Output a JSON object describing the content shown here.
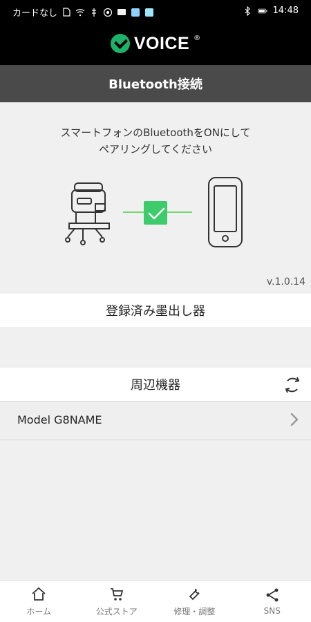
{
  "status_bar": {
    "carrier": "カードなし",
    "time": "14:48",
    "icons": [
      "sim-card-icon",
      "wifi-icon",
      "usb-icon",
      "app-icon",
      "mail-icon",
      "photo-icon",
      "battery-icon",
      "bluetooth-icon"
    ]
  },
  "app": {
    "brand": "VOICE",
    "trademark": "®",
    "title": "Bluetooth接続"
  },
  "pairing": {
    "instruction_line1": "スマートフォンのBluetoothをONにして",
    "instruction_line2": "ペアリングしてください",
    "version": "v.1.0.14"
  },
  "sections": {
    "registered_label": "登録済み墨出し器",
    "nearby_label": "周辺機器"
  },
  "devices": [
    {
      "label": "Model G8NAME"
    }
  ],
  "bottom_nav": [
    {
      "label": "ホーム",
      "icon": "home-icon"
    },
    {
      "label": "公式ストア",
      "icon": "cart-icon"
    },
    {
      "label": "修理・調整",
      "icon": "wrench-icon"
    },
    {
      "label": "SNS",
      "icon": "share-icon"
    }
  ],
  "colors": {
    "brand_green": "#1db26a",
    "title_bar": "#4a4a4a",
    "status_bar": "#000000"
  }
}
